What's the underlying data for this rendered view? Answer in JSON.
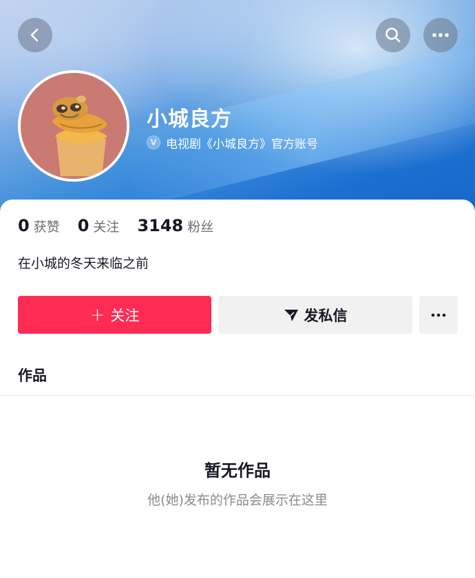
{
  "profile": {
    "name": "小城良方",
    "verify_badge": "V",
    "verification": "电视剧《小城良方》官方账号",
    "bio": "在小城的冬天来临之前"
  },
  "stats": [
    {
      "value": "0",
      "label": "获赞"
    },
    {
      "value": "0",
      "label": "关注"
    },
    {
      "value": "3148",
      "label": "粉丝"
    }
  ],
  "actions": {
    "follow_plus": "+",
    "follow_label": "关注",
    "message_label": "发私信"
  },
  "tabs": {
    "works_label": "作品"
  },
  "empty_state": {
    "title": "暂无作品",
    "subtitle": "他(她)发布的作品会展示在这里"
  },
  "icons": {
    "back": "chevron-left-icon",
    "search": "search-icon",
    "more": "more-horizontal-icon",
    "message": "paper-plane-icon"
  },
  "colors": {
    "accent": "#fe2c55",
    "secondary_button": "#f1f1f2",
    "header_blue": "#1c6fd1"
  }
}
